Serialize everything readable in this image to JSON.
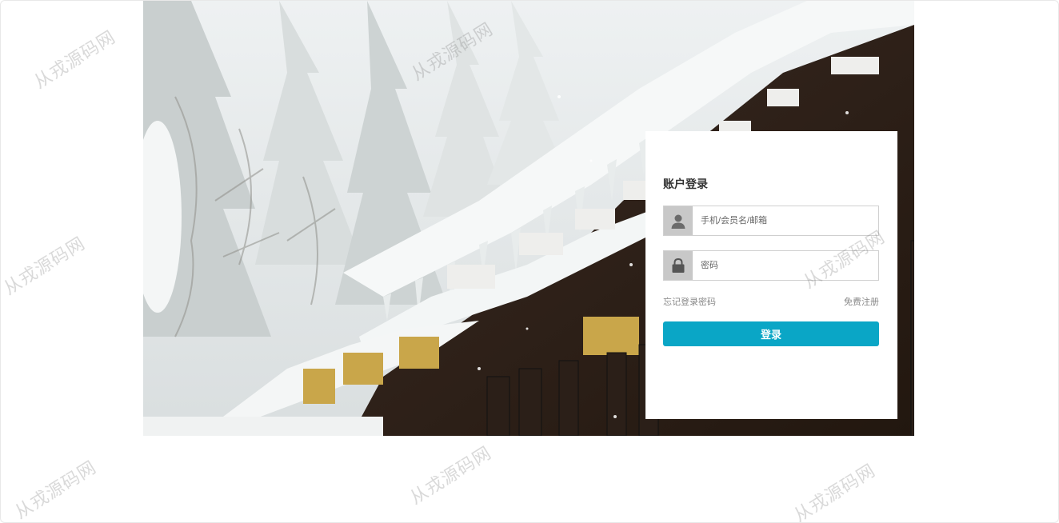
{
  "login": {
    "title": "账户登录",
    "username_placeholder": "手机/会员名/邮箱",
    "password_placeholder": "密码",
    "forgot_label": "忘记登录密码",
    "register_label": "免费注册",
    "submit_label": "登录",
    "accent_color": "#0aa6c6"
  },
  "banner": {
    "alt": "snow-covered wooden inn banner"
  },
  "watermark": {
    "text": "从戎源码网"
  }
}
